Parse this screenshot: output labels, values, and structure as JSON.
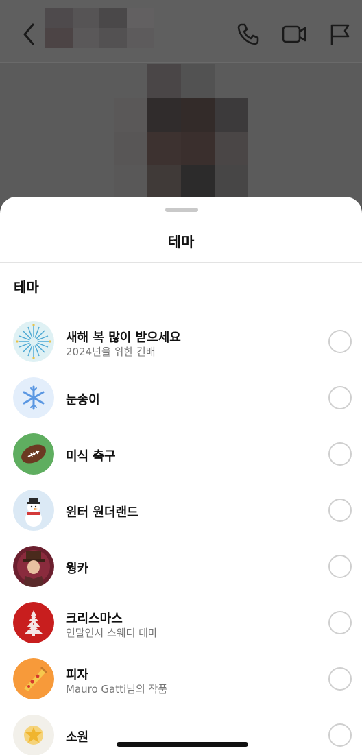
{
  "header": {
    "back_icon": "chevron-left-icon",
    "actions": [
      {
        "icon": "phone-icon"
      },
      {
        "icon": "video-camera-icon"
      },
      {
        "icon": "flag-icon"
      }
    ]
  },
  "sheet": {
    "title": "테마",
    "section_label": "테마",
    "themes": [
      {
        "title": "새해 복 많이 받으세요",
        "subtitle": "2024년을 위한 건배",
        "icon": "firework-icon",
        "selected": false
      },
      {
        "title": "눈송이",
        "subtitle": "",
        "icon": "snowflake-icon",
        "selected": false
      },
      {
        "title": "미식 축구",
        "subtitle": "",
        "icon": "football-icon",
        "selected": false
      },
      {
        "title": "윈터 원더랜드",
        "subtitle": "",
        "icon": "snowman-icon",
        "selected": false
      },
      {
        "title": "웡카",
        "subtitle": "",
        "icon": "wonka-portrait-icon",
        "selected": false
      },
      {
        "title": "크리스마스",
        "subtitle": "연말연시 스웨터 테마",
        "icon": "christmas-sweater-icon",
        "selected": false
      },
      {
        "title": "피자",
        "subtitle": "Mauro Gatti님의 작품",
        "icon": "pizza-icon",
        "selected": false
      },
      {
        "title": "소원",
        "subtitle": "",
        "icon": "wish-star-icon",
        "selected": false
      }
    ]
  },
  "colors": {
    "overlay": "#5b5b5b",
    "sheet_bg": "#ffffff",
    "radio_border": "#cfcfcf"
  }
}
